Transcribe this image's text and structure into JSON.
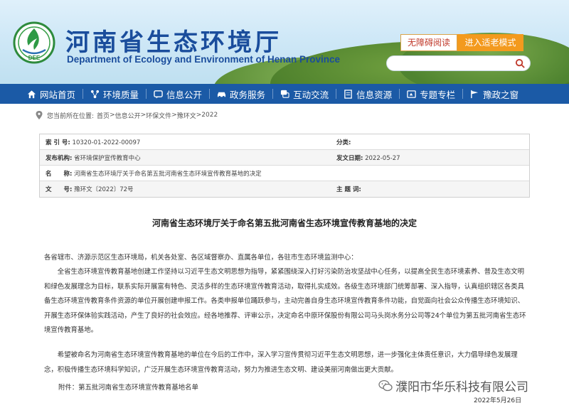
{
  "header": {
    "title_cn": "河南省生态环境厅",
    "title_en": "Department of Ecology and Environment of Henan Province",
    "logo_text": "DEE",
    "btn_accessibility": "无障碍阅读",
    "btn_elder": "进入适老模式",
    "search_placeholder": ""
  },
  "nav": {
    "items": [
      {
        "label": "网站首页",
        "icon": "home-icon"
      },
      {
        "label": "环境质量",
        "icon": "network-icon"
      },
      {
        "label": "信息公开",
        "icon": "message-icon"
      },
      {
        "label": "政务服务",
        "icon": "car-icon"
      },
      {
        "label": "互动交流",
        "icon": "chat-icon"
      },
      {
        "label": "信息资源",
        "icon": "document-icon"
      },
      {
        "label": "专题专栏",
        "icon": "topic-icon"
      },
      {
        "label": "豫政之窗",
        "icon": "flag-icon"
      }
    ]
  },
  "breadcrumb": {
    "prefix": "您当前所在位置:",
    "items": [
      "首页",
      "信息公开",
      "环保文件",
      "豫环文",
      "2022"
    ],
    "separator": " > "
  },
  "info": {
    "index_label": "索 引 号:",
    "index_value": "10320-01-2022-00097",
    "category_label": "分类:",
    "category_value": "",
    "issuer_label": "发布机构:",
    "issuer_value": "省环境保护宣传教育中心",
    "date_label": "发文日期:",
    "date_value": "2022-05-27",
    "name_label": "名　　称:",
    "name_value": "河南省生态环境厅关于命名第五批河南省生态环境宣传教育基地的决定",
    "docno_label": "文　　号:",
    "docno_value": "豫环文〔2022〕72号",
    "subject_label": "主 题 词:",
    "subject_value": ""
  },
  "article": {
    "title": "河南省生态环境厅关于命名第五批河南省生态环境宣传教育基地的决定",
    "salutation": "各省辖市、济源示范区生态环境局，机关各处室、各区域督察办、直属各单位，各驻市生态环境监测中心：",
    "paragraph1": "全省生态环境宣传教育基地创建工作坚持以习近平生态文明思想为指导，紧紧围绕深入打好污染防治攻坚战中心任务，以提高全民生态环境素养、普及生态文明和绿色发展理念为目标，联系实际开展富有特色、灵活多样的生态环境宣传教育活动，取得扎实成效。各级生态环境部门统筹部署、深入指导，认真组织辖区各类具备生态环境宣传教育条件资源的单位开展创建申报工作。各类申报单位踊跃参与，主动完善自身生态环境宣传教育条件功能，自觉面向社会公众传播生态环境知识、开展生态环保体验实践活动，产生了良好的社会效应。经各地推荐、评审公示，决定命名中原环保股份有限公司马头岗水务分公司等24个单位为第五批河南省生态环境宣传教育基地。",
    "paragraph2": "希望被命名为河南省生态环境宣传教育基地的单位在今后的工作中，深入学习宣传贯彻习近平生态文明思想，进一步强化主体责任意识，大力倡导绿色发展理念，积极传播生态环境科学知识，广泛开展生态环境宣传教育活动，努力为推进生态文明、建设美丽河南做出更大贡献。",
    "attachment": "附件：第五批河南省生态环境宣传教育基地名单",
    "date": "2022年5月26日"
  },
  "watermark": {
    "text": "濮阳市华乐科技有限公司"
  },
  "colors": {
    "brand_blue": "#1a4d9c",
    "nav_blue": "#1b5aa6",
    "accent_orange": "#f39a1e",
    "accent_red": "#c0392b"
  }
}
